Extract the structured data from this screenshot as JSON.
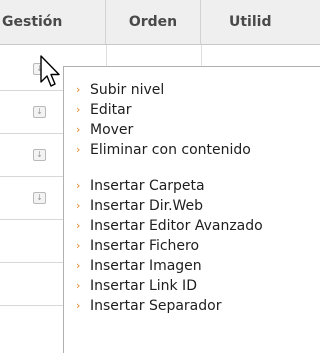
{
  "header": {
    "col_gestion": "Gestión",
    "col_orden": "Orden",
    "col_utilidad": "Utilid"
  },
  "menu": {
    "items": [
      {
        "label": "Subir nivel"
      },
      {
        "label": "Editar"
      },
      {
        "label": "Mover"
      },
      {
        "label": "Eliminar con contenido"
      },
      {
        "label": "Insertar Carpeta"
      },
      {
        "label": "Insertar Dir.Web"
      },
      {
        "label": "Insertar Editor Avanzado"
      },
      {
        "label": "Insertar Fichero"
      },
      {
        "label": "Insertar Imagen"
      },
      {
        "label": "Insertar Link ID"
      },
      {
        "label": "Insertar Separador"
      }
    ]
  },
  "icons": {
    "row_button": "down-arrow-icon",
    "menu_bullet": "chevron-right-icon",
    "pointer": "mouse-pointer-icon"
  },
  "colors": {
    "header_bg": "#efefef",
    "bullet": "#e08a2a",
    "text": "#1e1e1e"
  }
}
